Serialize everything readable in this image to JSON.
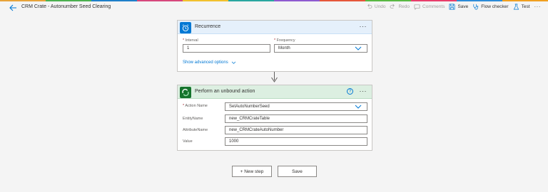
{
  "colors": {
    "accent": "#0078d4",
    "recurrence_header_bg": "#e5f0fb",
    "action_header_bg": "#dcefe1",
    "dataverse_green": "#15742c",
    "rainbow": [
      "#e8a33a",
      "#4bb04f",
      "#1e7fc9",
      "#d7487c",
      "#f2c12e",
      "#2aa6a0",
      "#8e5ad0",
      "#e6563a",
      "#59b843",
      "#e93e6b",
      "#2d8cd8",
      "#f0a020"
    ]
  },
  "header": {
    "title": "CRM Crate - Autonumber Seed Clearing",
    "commands": {
      "undo": "Undo",
      "redo": "Redo",
      "comments": "Comments",
      "save": "Save",
      "flow_checker": "Flow checker",
      "test": "Test",
      "more": "···"
    }
  },
  "recurrence": {
    "title": "Recurrence",
    "more": "···",
    "interval_label": "Interval",
    "interval_value": "1",
    "frequency_label": "Frequency",
    "frequency_value": "Month",
    "advanced_link": "Show advanced options",
    "required_marker": "*"
  },
  "action": {
    "title": "Perform an unbound action",
    "help": "?",
    "more": "···",
    "required_marker": "*",
    "fields": {
      "action_name_label": "Action Name",
      "action_name_value": "SetAutoNumberSeed",
      "entity_label": "EntityName",
      "entity_value": "new_CRMCrateTable",
      "attribute_label": "AttributeName",
      "attribute_value": "new_CRMCrateAutoNumber",
      "value_label": "Value",
      "value_value": "1000"
    }
  },
  "footer": {
    "new_step": "+ New step",
    "save": "Save"
  }
}
